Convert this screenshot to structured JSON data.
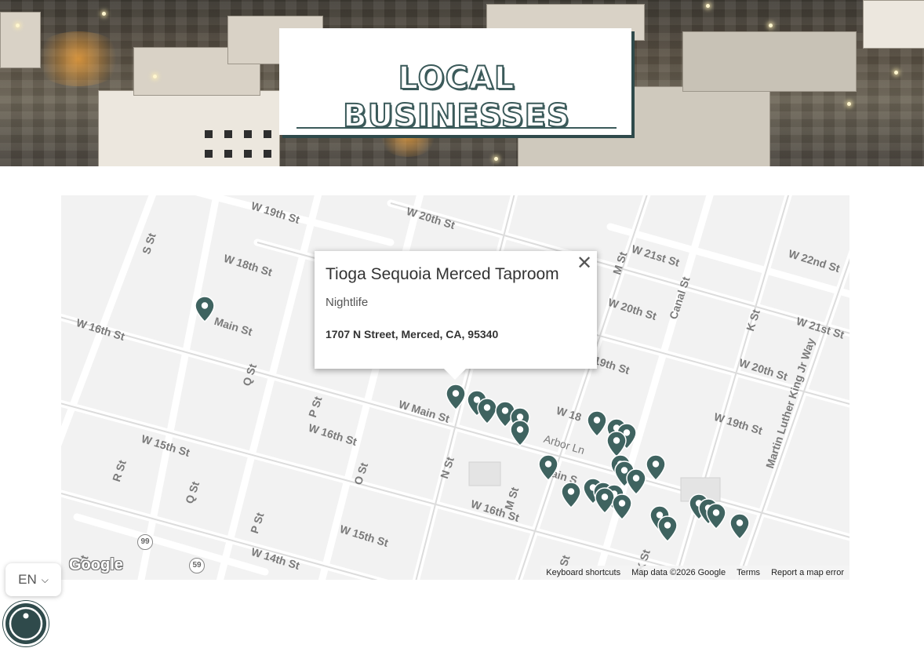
{
  "hero": {
    "title": "LOCAL BUSINESSES"
  },
  "map": {
    "streets": [
      "W 19th St",
      "W 20th St",
      "W 18th St",
      "S St",
      "M St",
      "W 21st St",
      "W 22nd St",
      "Main St",
      "W 16th St",
      "Canal St",
      "W 20th St",
      "K St",
      "W 21st St",
      "Q St",
      "P St",
      "19th St",
      "W 20th St",
      "Martin Luther King Jr Way",
      "W Main St",
      "W 18",
      "W 16th St",
      "W 19th St",
      "Arbor Ln",
      "W 15th St",
      "R St",
      "Q St",
      "O St",
      "N St",
      "ain S",
      "M St",
      "W 16th St",
      "P St",
      "W 15th St",
      "W 14th St",
      "K St",
      "St",
      "St"
    ],
    "shields": [
      "99",
      "59"
    ],
    "popup": {
      "name": "Tioga Sequoia Merced Taproom",
      "category": "Nightlife",
      "address": "1707 N Street, Merced, CA, 95340",
      "close_symbol": "✕"
    },
    "logo": "Google",
    "footer": {
      "keyboard_shortcuts": "Keyboard shortcuts",
      "map_data": "Map data ©2026 Google",
      "terms": "Terms",
      "report": "Report a map error"
    },
    "pin_color": "#3f6360"
  },
  "language": {
    "code": "EN"
  },
  "accessibility": {
    "icon": "accessibility-icon"
  }
}
